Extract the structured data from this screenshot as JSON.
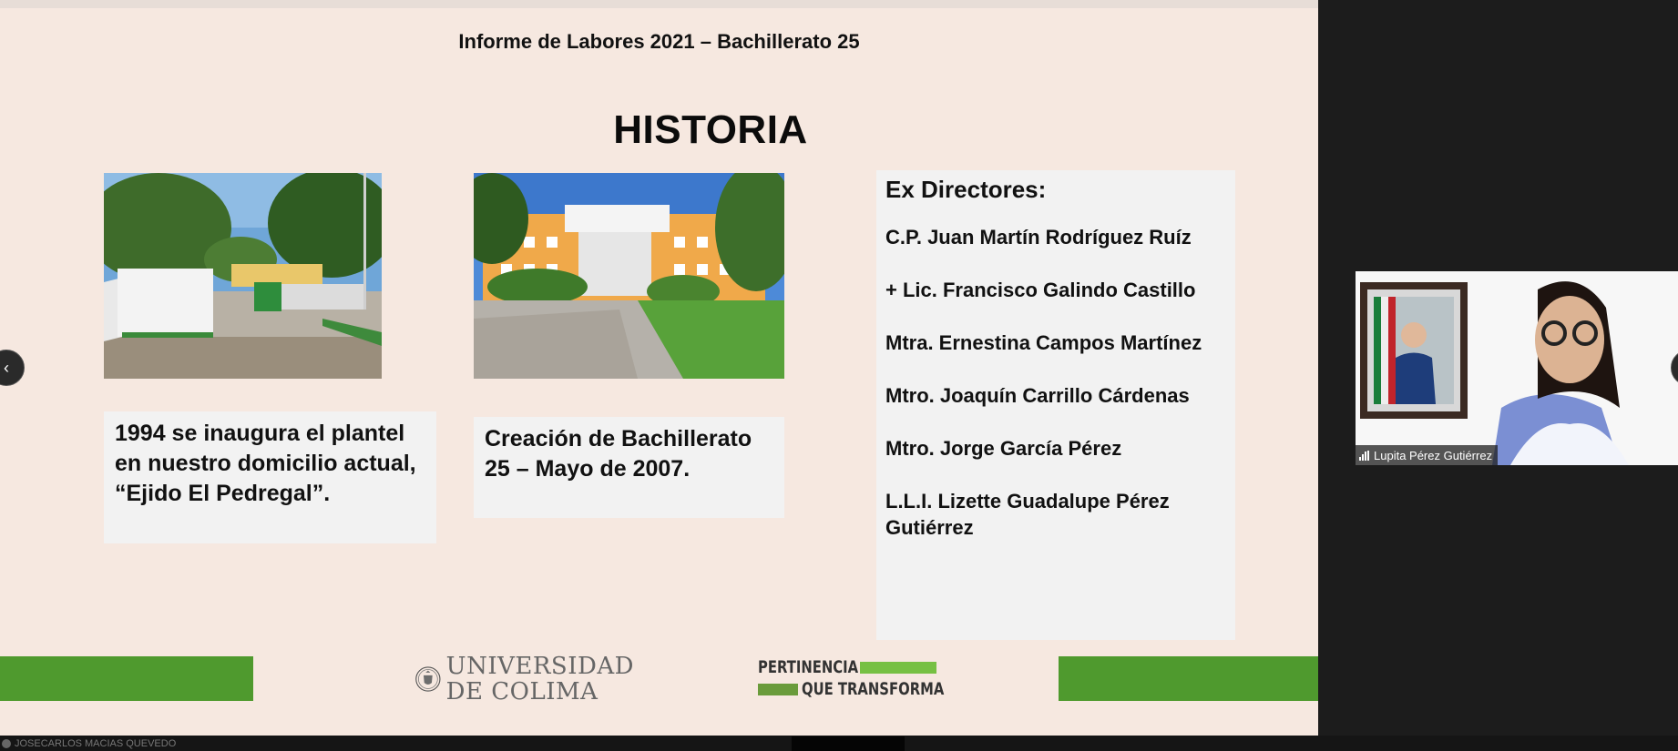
{
  "slide": {
    "header": "Informe de Labores 2021 – Bachillerato 25",
    "title": "HISTORIA",
    "caption_1": "1994 se inaugura el plantel en nuestro domicilio actual, “Ejido El Pedregal”.",
    "caption_2": "Creación de Bachillerato 25 – Mayo de 2007.",
    "directors": {
      "heading": "Ex Directores:",
      "items": [
        "C.P. Juan Martín Rodríguez Ruíz",
        "+ Lic. Francisco Galindo Castillo",
        "Mtra. Ernestina Campos Martínez",
        "Mtro. Joaquín Carrillo Cárdenas",
        "Mtro. Jorge García Pérez",
        "L.L.I. Lizette Guadalupe Pérez Gutiérrez"
      ]
    },
    "logo_university_line1": "UNIVERSIDAD",
    "logo_university_line2": "DE COLIMA",
    "logo_slogan_line1": "PERTINENCIA",
    "logo_slogan_line2": "QUE TRANSFORMA",
    "colors": {
      "background": "#f6e8e0",
      "accent_green": "#4f9a2e"
    }
  },
  "participant": {
    "name": "Lupita Pérez Gutiérrez"
  },
  "bottom": {
    "speaker_name": "JOSECARLOS MACIAS QUEVEDO"
  },
  "icons": {
    "prev": "‹",
    "next": "›"
  }
}
